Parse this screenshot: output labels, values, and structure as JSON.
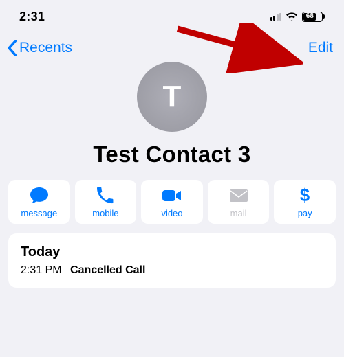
{
  "status": {
    "time": "2:31",
    "battery": "68"
  },
  "nav": {
    "back": "Recents",
    "edit": "Edit"
  },
  "contact": {
    "initial": "T",
    "name": "Test Contact 3"
  },
  "actions": {
    "message": "message",
    "mobile": "mobile",
    "video": "video",
    "mail": "mail",
    "pay": "pay"
  },
  "history": {
    "heading": "Today",
    "entries": [
      {
        "time": "2:31 PM",
        "label": "Cancelled Call"
      }
    ]
  },
  "colors": {
    "accent": "#007aff",
    "disabled": "#c2c2c7"
  }
}
